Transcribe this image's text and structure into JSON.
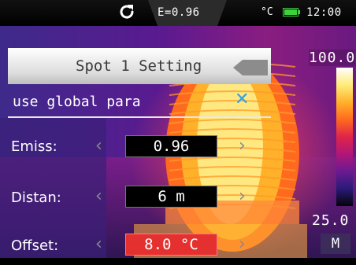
{
  "status_bar": {
    "refresh_icon": "refresh-icon",
    "emissivity": "E=0.96",
    "unit": "°C",
    "battery_icon": "battery-icon",
    "battery_color": "#3fd23f",
    "clock": "12:00"
  },
  "panel": {
    "title": "Spot 1 Setting",
    "back_icon": "back-arrow-icon",
    "global_label": "use global para",
    "close_icon": "close-icon",
    "close_glyph": "✕",
    "close_color": "#2aa3e8"
  },
  "params": [
    {
      "label": "Emiss:",
      "value": "0.96",
      "active": false
    },
    {
      "label": "Distan:",
      "value": "6 m",
      "active": false
    },
    {
      "label": "Offset:",
      "value": "8.0 °C",
      "active": true
    }
  ],
  "arrows": {
    "left": "‹",
    "right": "›"
  },
  "scale": {
    "max": "100.0",
    "min": "25.0",
    "mode": "M",
    "colors": [
      "#ffffff",
      "#ffec7a",
      "#ffb12a",
      "#ff6a1e",
      "#e0244a",
      "#b01678",
      "#6a1a92",
      "#2a1a78",
      "#05040a"
    ]
  },
  "active_color": "#e4302f"
}
